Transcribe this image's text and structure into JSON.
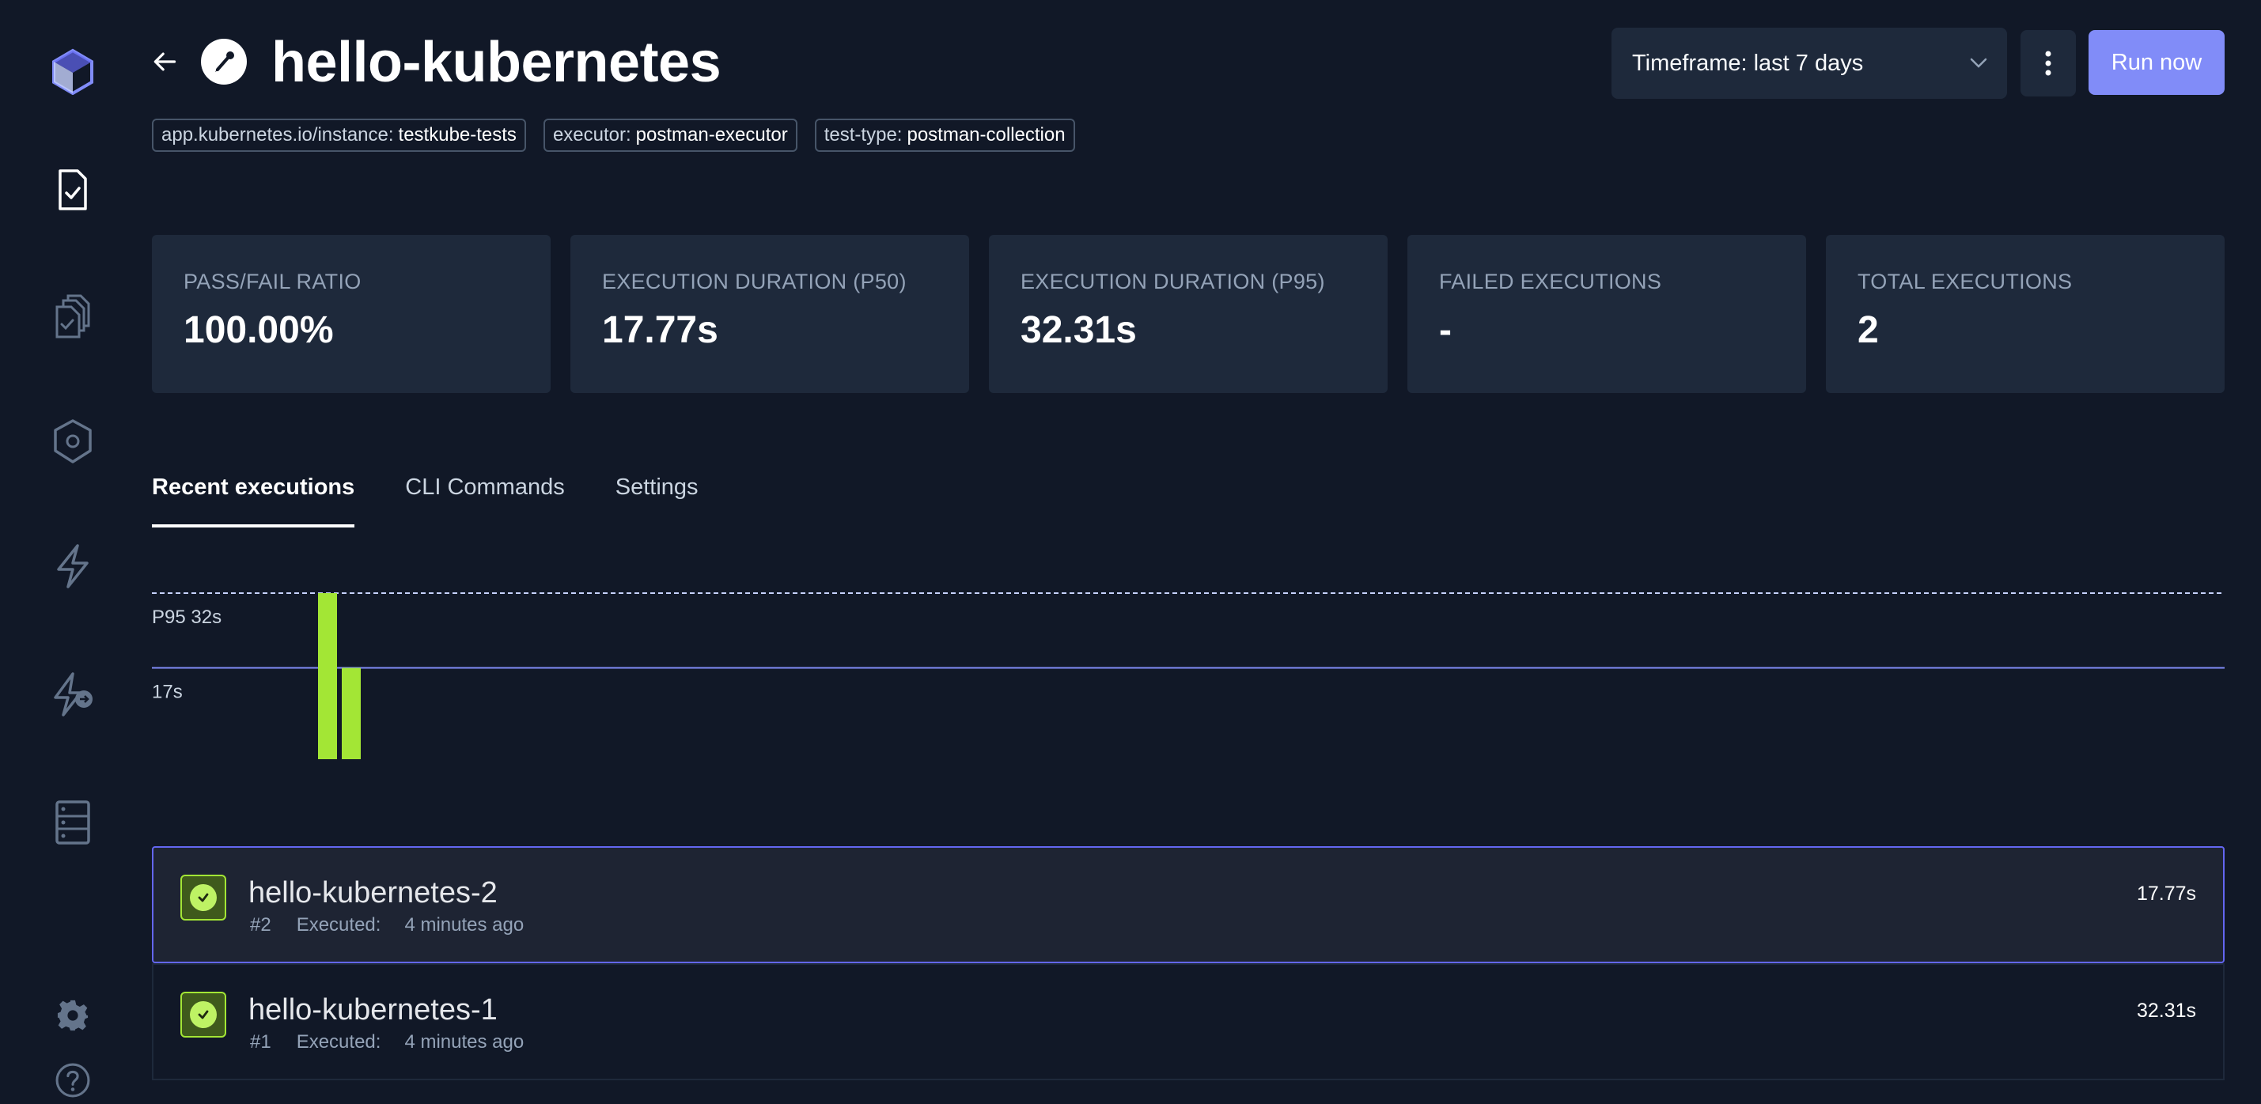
{
  "sidebar": {
    "items": [
      {
        "icon": "testkube-logo-icon"
      },
      {
        "icon": "tests-icon"
      },
      {
        "icon": "test-suites-icon"
      },
      {
        "icon": "executors-icon"
      },
      {
        "icon": "triggers-icon"
      },
      {
        "icon": "webhooks-icon"
      },
      {
        "icon": "sources-icon"
      },
      {
        "icon": "settings-gear-icon"
      },
      {
        "icon": "help-icon"
      }
    ]
  },
  "header": {
    "title": "hello-kubernetes",
    "type_icon": "postman-icon",
    "labels": [
      {
        "key": "app.kubernetes.io/instance:",
        "value": "testkube-tests"
      },
      {
        "key": "executor:",
        "value": "postman-executor"
      },
      {
        "key": "test-type:",
        "value": "postman-collection"
      }
    ],
    "timeframe": "Timeframe: last 7 days",
    "run_label": "Run now"
  },
  "metrics": [
    {
      "label": "PASS/FAIL RATIO",
      "value": "100.00%"
    },
    {
      "label": "EXECUTION DURATION (P50)",
      "value": "17.77s"
    },
    {
      "label": "EXECUTION DURATION (P95)",
      "value": "32.31s"
    },
    {
      "label": "FAILED EXECUTIONS",
      "value": "-"
    },
    {
      "label": "TOTAL EXECUTIONS",
      "value": "2"
    }
  ],
  "tabs": [
    {
      "label": "Recent executions",
      "active": true
    },
    {
      "label": "CLI Commands",
      "active": false
    },
    {
      "label": "Settings",
      "active": false
    }
  ],
  "chart_data": {
    "type": "bar",
    "values": [
      32.31,
      17.77
    ],
    "ylim": [
      0,
      32.31
    ],
    "reference_lines": [
      {
        "label": "P95 32s",
        "value": 32.31,
        "style": "dashed"
      },
      {
        "label": "17s",
        "value": 17.77,
        "style": "solid"
      }
    ],
    "bar_color": "#a3e635",
    "line_color": "#818cf8"
  },
  "executions": [
    {
      "name": "hello-kubernetes-2",
      "number": "#2",
      "executed_label": "Executed:",
      "executed": "4 minutes ago",
      "duration": "17.77s",
      "status": "passed"
    },
    {
      "name": "hello-kubernetes-1",
      "number": "#1",
      "executed_label": "Executed:",
      "executed": "4 minutes ago",
      "duration": "32.31s",
      "status": "passed"
    }
  ],
  "colors": {
    "accent": "#818cf8",
    "success": "#a3e635",
    "background": "#111827",
    "card": "#1e293b"
  }
}
